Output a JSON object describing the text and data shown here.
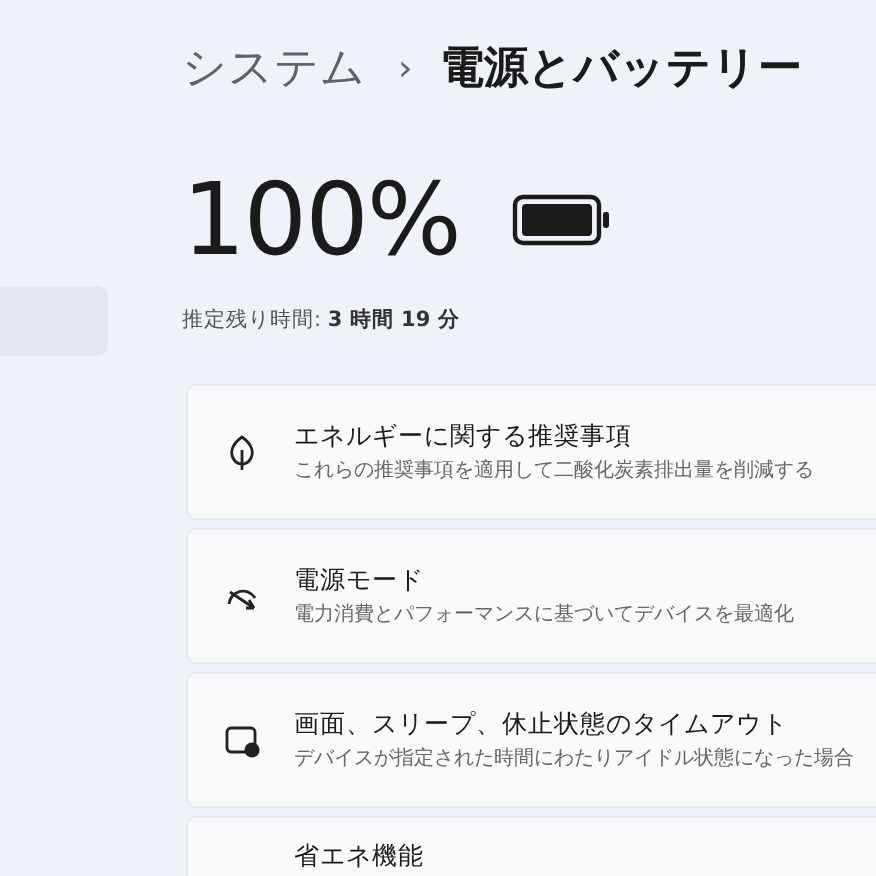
{
  "breadcrumb": {
    "parent": "システム",
    "separator": "›",
    "current": "電源とバッテリー"
  },
  "battery": {
    "percent": "100%",
    "level": 1.0,
    "estimate_label": "推定残り時間:",
    "estimate_value": "3 時間 19 分"
  },
  "settings": [
    {
      "kind": "leaf",
      "title": "エネルギーに関する推奨事項",
      "description": "これらの推奨事項を適用して二酸化炭素排出量を削減する"
    },
    {
      "kind": "gauge",
      "title": "電源モード",
      "description": "電力消費とパフォーマンスに基づいてデバイスを最適化"
    },
    {
      "kind": "screen",
      "title": "画面、スリープ、休止状態のタイムアウト",
      "description": "デバイスが指定された時間にわたりアイドル状態になった場合"
    },
    {
      "kind": "saver",
      "title": "省エネ機能"
    }
  ]
}
